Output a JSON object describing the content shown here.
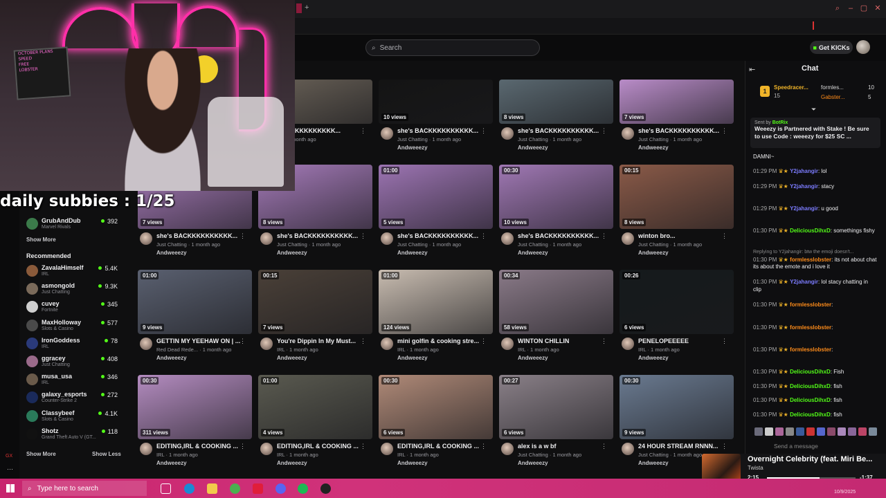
{
  "header": {
    "search_placeholder": "Search",
    "get_kicks_label": "Get KICKs"
  },
  "overlay": {
    "subs_text": "daily subbies : 1/25"
  },
  "sidebar": {
    "following": [
      {
        "name": "GrubAndDub",
        "category": "Marvel Rivals",
        "viewers": "392",
        "color": "#3b7a4a"
      }
    ],
    "show_more_label": "Show More",
    "recommended_title": "Recommended",
    "recommended": [
      {
        "name": "ZavalaHimself",
        "category": "IRL",
        "viewers": "5.4K",
        "color": "#8a5a3a"
      },
      {
        "name": "asmongold",
        "category": "Just Chatting",
        "viewers": "9.3K",
        "color": "#7a6a5a"
      },
      {
        "name": "cuvey",
        "category": "Fortnite",
        "viewers": "345",
        "color": "#cfcfcf"
      },
      {
        "name": "MaxHolloway",
        "category": "Slots & Casino",
        "viewers": "577",
        "color": "#4a4a4a"
      },
      {
        "name": "IronGoddess",
        "category": "IRL",
        "viewers": "78",
        "color": "#2a3a7a"
      },
      {
        "name": "ggracey",
        "category": "Just Chatting",
        "viewers": "408",
        "color": "#9a6a8a"
      },
      {
        "name": "musa_usa",
        "category": "IRL",
        "viewers": "346",
        "color": "#6a5a4a"
      },
      {
        "name": "galaxy_esports",
        "category": "Counter-Strike 2",
        "viewers": "272",
        "color": "#1a2a5a"
      },
      {
        "name": "Classybeef",
        "category": "Slots & Casino",
        "viewers": "4.1K",
        "color": "#2a7a5a"
      },
      {
        "name": "Shotz",
        "category": "Grand Theft Auto V (GT...",
        "viewers": "118",
        "color": "#111111"
      }
    ],
    "show_more_bottom": "Show More",
    "show_less_label": "Show Less"
  },
  "clips": [
    [
      {
        "duration": "",
        "views": "",
        "title": "BACKKKKKKKKKK...",
        "meta": "ng · 1 month ago",
        "author": "eezy",
        "thumb": "#6a6258"
      },
      {
        "duration": "",
        "views": "10 views",
        "title": "she's BACKKKKKKKKKK...",
        "meta": "Just Chatting · 1 month ago",
        "author": "Andweeezy",
        "thumb": "#141414"
      },
      {
        "duration": "",
        "views": "8 views",
        "title": "she's BACKKKKKKKKKK...",
        "meta": "Just Chatting · 1 month ago",
        "author": "Andweeezy",
        "thumb": "#5a6870"
      },
      {
        "duration": "",
        "views": "7 views",
        "title": "she's BACKKKKKKKKKK...",
        "meta": "Just Chatting · 1 month ago",
        "author": "Andweeezy",
        "thumb": "#b98cc8"
      }
    ],
    [
      {
        "duration": "",
        "views": "7 views",
        "title": "she's BACKKKKKKKKKK...",
        "meta": "Just Chatting · 1 month ago",
        "author": "Andweeezy",
        "thumb": "#a67ab8"
      },
      {
        "duration": "",
        "views": "8 views",
        "title": "she's BACKKKKKKKKKK...",
        "meta": "Just Chatting · 1 month ago",
        "author": "Andweeezy",
        "thumb": "#a47ab8"
      },
      {
        "duration": "01:00",
        "views": "5 views",
        "title": "she's BACKKKKKKKKKK...",
        "meta": "Just Chatting · 1 month ago",
        "author": "Andweeezy",
        "thumb": "#9c74b2"
      },
      {
        "duration": "00:30",
        "views": "10 views",
        "title": "she's BACKKKKKKKKKK...",
        "meta": "Just Chatting · 1 month ago",
        "author": "Andweeezy",
        "thumb": "#a078b4"
      },
      {
        "duration": "00:15",
        "views": "8 views",
        "title": "winton bro...",
        "meta": "Just Chatting · 1 month ago",
        "author": "Andweeezy",
        "thumb": "#8a5a48"
      }
    ],
    [
      {
        "duration": "01:00",
        "views": "9 views",
        "title": "GETTIN MY YEEHAW ON | ...",
        "meta": "Red Dead Rede... · 1 month ago",
        "author": "Andweeezy",
        "thumb": "#5a6070"
      },
      {
        "duration": "00:15",
        "views": "7 views",
        "title": "You're Dippin In My Must...",
        "meta": "IRL · 1 month ago",
        "author": "Andweeezy",
        "thumb": "#4a4038"
      },
      {
        "duration": "01:00",
        "views": "124 views",
        "title": "mini golfin & cooking stre...",
        "meta": "IRL · 1 month ago",
        "author": "Andweeezy",
        "thumb": "#c8bcb0"
      },
      {
        "duration": "00:34",
        "views": "58 views",
        "title": "WINTON CHILLIN",
        "meta": "IRL · 1 month ago",
        "author": "Andweeezy",
        "thumb": "#8a7a88"
      },
      {
        "duration": "00:26",
        "views": "6 views",
        "title": "PENELOPEEEEE",
        "meta": "IRL · 1 month ago",
        "author": "Andweeezy",
        "thumb": "#151a1c"
      }
    ],
    [
      {
        "duration": "00:30",
        "views": "311 views",
        "title": "EDITING,IRL & COOKING ...",
        "meta": "IRL · 1 month ago",
        "author": "Andweeezy",
        "thumb": "#b48cc0"
      },
      {
        "duration": "01:00",
        "views": "4 views",
        "title": "EDITING,IRL & COOKING ...",
        "meta": "IRL · 1 month ago",
        "author": "Andweeezy",
        "thumb": "#5a5a50"
      },
      {
        "duration": "00:30",
        "views": "6 views",
        "title": "EDITING,IRL & COOKING ...",
        "meta": "IRL · 1 month ago",
        "author": "Andweeezy",
        "thumb": "#b08a78"
      },
      {
        "duration": "00:27",
        "views": "6 views",
        "title": "alex is a w bf",
        "meta": "Just Chatting · 1 month ago",
        "author": "Andweeezy",
        "thumb": "#8a8088"
      },
      {
        "duration": "00:30",
        "views": "9 views",
        "title": "24 HOUR STREAM RNNN...",
        "meta": "Just Chatting · 1 month ago",
        "author": "Andweeezy",
        "thumb": "#6a7a90"
      }
    ]
  ],
  "chat": {
    "title": "Chat",
    "leaderboard": [
      {
        "rank": "1",
        "name": "Speedracer...",
        "count": "15"
      },
      {
        "name": "formles...",
        "count": "10"
      },
      {
        "name": "Gabster...",
        "count": "5"
      }
    ],
    "pinned": {
      "sent_by": "Sent by",
      "bot": "BotRix",
      "text": "Weeezy is Partnered with Stake ! Be sure to use Code : weeezy for $25 SC ..."
    },
    "messages": [
      {
        "time": "",
        "user": "",
        "text": "DAMNI~",
        "color": "#53fc18"
      },
      {
        "time": "01:29 PM",
        "user": "Y2jahangir",
        "text": ": lol",
        "color": "#7c7cff"
      },
      {
        "time": "01:29 PM",
        "user": "Y2jahangir",
        "text": ": stacy",
        "color": "#7c7cff"
      },
      {
        "time": "01:29 PM",
        "user": "Y2jahangir",
        "text": ": u good",
        "color": "#7c7cff"
      },
      {
        "time": "01:30 PM",
        "user": "DeliciousDihxD",
        "text": ": somethings fishy",
        "color": "#53fc18"
      },
      {
        "time": "01:30 PM",
        "user": "formlesslobster",
        "text": ": its not about chat its about the emote and i love it",
        "color": "#ff8c1a",
        "reply": "Replying to Y2jahangir: btw the emoji doesn't..."
      },
      {
        "time": "01:30 PM",
        "user": "Y2jahangir",
        "text": ": lol stacy chatting in clip",
        "color": "#7c7cff"
      },
      {
        "time": "01:30 PM",
        "user": "formlesslobster",
        "text": ":",
        "color": "#ff8c1a"
      },
      {
        "time": "01:30 PM",
        "user": "formlesslobster",
        "text": ":",
        "color": "#ff8c1a"
      },
      {
        "time": "01:30 PM",
        "user": "formlesslobster",
        "text": ":",
        "color": "#ff8c1a"
      },
      {
        "time": "01:30 PM",
        "user": "DeliciousDihxD",
        "text": ": Fish",
        "color": "#53fc18"
      },
      {
        "time": "01:30 PM",
        "user": "DeliciousDihxD",
        "text": ": fish",
        "color": "#53fc18"
      },
      {
        "time": "01:30 PM",
        "user": "DeliciousDihxD",
        "text": ": fish",
        "color": "#53fc18"
      },
      {
        "time": "01:30 PM",
        "user": "DeliciousDihxD",
        "text": ": fish",
        "color": "#53fc18"
      }
    ],
    "input_placeholder": "Send a message"
  },
  "music": {
    "title": "Overnight Celebrity (feat. Miri Be...",
    "artist": "Twista",
    "elapsed": "2:15",
    "remaining": "-1:37",
    "progress": 0.59
  },
  "taskbar": {
    "search_placeholder": "Type here to search",
    "date": "10/9/2025"
  },
  "colors": {
    "accent": "#53fc18",
    "neon": "#ff2fa8",
    "taskbar": "#c8256e"
  }
}
